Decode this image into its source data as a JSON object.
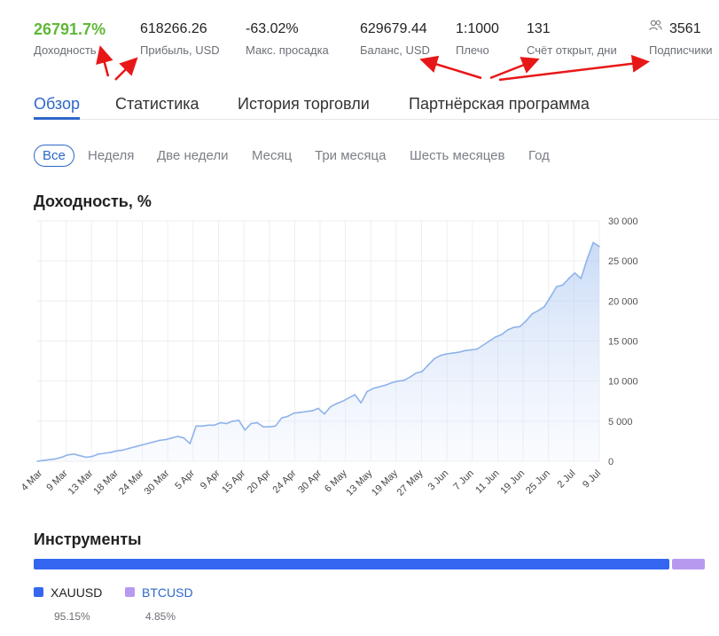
{
  "stats": [
    {
      "value": "26791.7%",
      "label": "Доходность"
    },
    {
      "value": "618266.26",
      "label": "Прибыль, USD"
    },
    {
      "value": "-63.02%",
      "label": "Макс. просадка"
    },
    {
      "value": "629679.44",
      "label": "Баланс, USD"
    },
    {
      "value": "1:1000",
      "label": "Плечо"
    },
    {
      "value": "131",
      "label": "Счёт открыт, дни"
    },
    {
      "value": "3561",
      "label": "Подписчики",
      "icon": "users-icon"
    }
  ],
  "tabs": [
    "Обзор",
    "Статистика",
    "История торговли",
    "Партнёрская программа"
  ],
  "active_tab": "Обзор",
  "periods": [
    "Все",
    "Неделя",
    "Две недели",
    "Месяц",
    "Три месяца",
    "Шесть месяцев",
    "Год"
  ],
  "active_period": "Все",
  "chart_title": "Доходность, %",
  "chart_data": {
    "type": "area",
    "title": "Доходность, %",
    "xlabel": "",
    "ylabel": "",
    "ylim": [
      0,
      30000
    ],
    "yticks": [
      0,
      5000,
      10000,
      15000,
      20000,
      25000,
      30000
    ],
    "ytick_labels": [
      "0",
      "5 000",
      "10 000",
      "15 000",
      "20 000",
      "25 000",
      "30 000"
    ],
    "xtick_labels": [
      "4 Mar",
      "9 Mar",
      "13 Mar",
      "18 Mar",
      "24 Mar",
      "30 Mar",
      "5 Apr",
      "9 Apr",
      "15 Apr",
      "20 Apr",
      "24 Apr",
      "30 Apr",
      "6 May",
      "13 May",
      "19 May",
      "27 May",
      "3 Jun",
      "7 Jun",
      "11 Jun",
      "19 Jun",
      "25 Jun",
      "2 Jul",
      "9 Jul"
    ],
    "grid": true,
    "values": [
      0,
      100,
      200,
      300,
      500,
      800,
      900,
      700,
      500,
      600,
      900,
      1000,
      1100,
      1300,
      1400,
      1600,
      1800,
      2000,
      2200,
      2400,
      2600,
      2700,
      2900,
      3100,
      2900,
      2200,
      4400,
      4400,
      4500,
      4500,
      4800,
      4700,
      5000,
      5100,
      3900,
      4700,
      4800,
      4300,
      4300,
      4400,
      5400,
      5600,
      6000,
      6100,
      6200,
      6300,
      6600,
      5900,
      6800,
      7200,
      7500,
      7900,
      8300,
      7300,
      8700,
      9100,
      9300,
      9500,
      9800,
      10000,
      10100,
      10500,
      11000,
      11200,
      12000,
      12800,
      13200,
      13400,
      13500,
      13600,
      13800,
      13900,
      14000,
      14500,
      15000,
      15500,
      15800,
      16400,
      16700,
      16800,
      17500,
      18400,
      18800,
      19300,
      20500,
      21800,
      22000,
      22800,
      23500,
      22800,
      25200,
      27300,
      26800
    ]
  },
  "instruments_title": "Инструменты",
  "instruments": [
    {
      "name": "XAUUSD",
      "percent": "95.15%",
      "share": 95.15,
      "color": "#3466f2"
    },
    {
      "name": "BTCUSD",
      "percent": "4.85%",
      "share": 4.85,
      "color": "#b79af0"
    }
  ]
}
